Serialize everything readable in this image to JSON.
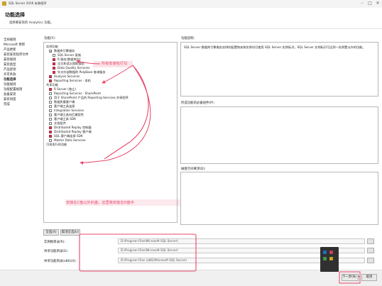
{
  "window": {
    "title": "SQL Server 2016 安装程序",
    "minimize": "–",
    "maximize": "□",
    "close": "✕"
  },
  "header": {
    "title": "功能选择",
    "subtitle": "选择要安装的 Analytics 功能。"
  },
  "sidebar": {
    "items": [
      {
        "label": "全局规则"
      },
      {
        "label": "Microsoft 更新"
      },
      {
        "label": "产品更新"
      },
      {
        "label": "安装安装程序文件"
      },
      {
        "label": "安装规则"
      },
      {
        "label": "安装类型"
      },
      {
        "label": "产品密钥"
      },
      {
        "label": "许可条款"
      },
      {
        "label": "功能选择",
        "active": true
      },
      {
        "label": "功能规则"
      },
      {
        "label": "功能配置规则"
      },
      {
        "label": "准备安装"
      },
      {
        "label": "安装进度"
      },
      {
        "label": "完成"
      }
    ]
  },
  "labels": {
    "features": "功能(F):",
    "feature_desc": "功能说明:",
    "prereqs": "所选功能的必备组件(P):",
    "disk": "磁盘空间要求(D):"
  },
  "description": "SQL Server 数据库引擎服务实例的配置和安装实例均可使用 SQL Server 实例标识。SQL Server 实例标识可达到一实例置以外的功能。",
  "tree": [
    {
      "label": "实例功能",
      "indent": 0,
      "state": "none"
    },
    {
      "label": "数据库引擎服务",
      "indent": 1,
      "state": "partial"
    },
    {
      "label": "SQL Server 复制",
      "indent": 2,
      "state": "unchecked"
    },
    {
      "label": "R 服务(数据库内)",
      "indent": 2,
      "state": "checked"
    },
    {
      "label": "全文和语义提取搜索",
      "indent": 2,
      "state": "checked"
    },
    {
      "label": "Data Quality Services",
      "indent": 2,
      "state": "checked"
    },
    {
      "label": "针对外部数据的 PolyBase 查询服务",
      "indent": 2,
      "state": "checked"
    },
    {
      "label": "Analysis Services",
      "indent": 1,
      "state": "checked"
    },
    {
      "label": "Reporting Services - 本机",
      "indent": 1,
      "state": "checked"
    },
    {
      "label": "共享功能",
      "indent": 0,
      "state": "none"
    },
    {
      "label": "R Server (独立)",
      "indent": 1,
      "state": "checked"
    },
    {
      "label": "Reporting Services - SharePoint",
      "indent": 1,
      "state": "unchecked"
    },
    {
      "label": "用于 SharePoint 产品的 Reporting Services 外接程序",
      "indent": 1,
      "state": "unchecked"
    },
    {
      "label": "数据质量客户端",
      "indent": 1,
      "state": "unchecked"
    },
    {
      "label": "客户端工具连接",
      "indent": 1,
      "state": "unchecked"
    },
    {
      "label": "Integration Services",
      "indent": 1,
      "state": "unchecked"
    },
    {
      "label": "客户端工具向后兼容性",
      "indent": 1,
      "state": "unchecked"
    },
    {
      "label": "客户端工具 SDK",
      "indent": 1,
      "state": "unchecked"
    },
    {
      "label": "文档组件",
      "indent": 1,
      "state": "unchecked"
    },
    {
      "label": "Distributed Replay 控制器",
      "indent": 1,
      "state": "checked"
    },
    {
      "label": "Distributed Replay 客户端",
      "indent": 1,
      "state": "checked"
    },
    {
      "label": "SQL 客户端连接 SDK",
      "indent": 1,
      "state": "checked"
    },
    {
      "label": "Master Data Services",
      "indent": 1,
      "state": "unchecked"
    },
    {
      "label": "可再发行的功能",
      "indent": 0,
      "state": "none"
    }
  ],
  "buttons": {
    "select_all": "全选(A)",
    "deselect_all": "取消全选(U)",
    "next": "下一步(N) >",
    "cancel": "取消"
  },
  "paths": [
    {
      "label": "实例根目录(R):",
      "value": "D:\\Program Files\\Microsoft SQL Server\\"
    },
    {
      "label": "共享功能目录(S):",
      "value": "D:\\Program Files\\Microsoft SQL Server\\"
    },
    {
      "label": "共享功能目录(x86)(X):",
      "value": "D:\\Program Files (x86)\\Microsoft SQL Server\\"
    }
  ],
  "annotations": {
    "a1": "所有安装包打勾",
    "a2": "安装在C盘以外的盘，这里我安装在D盘中"
  },
  "colors": {
    "annotation": "#e8476a",
    "checked": "#d13b55"
  }
}
